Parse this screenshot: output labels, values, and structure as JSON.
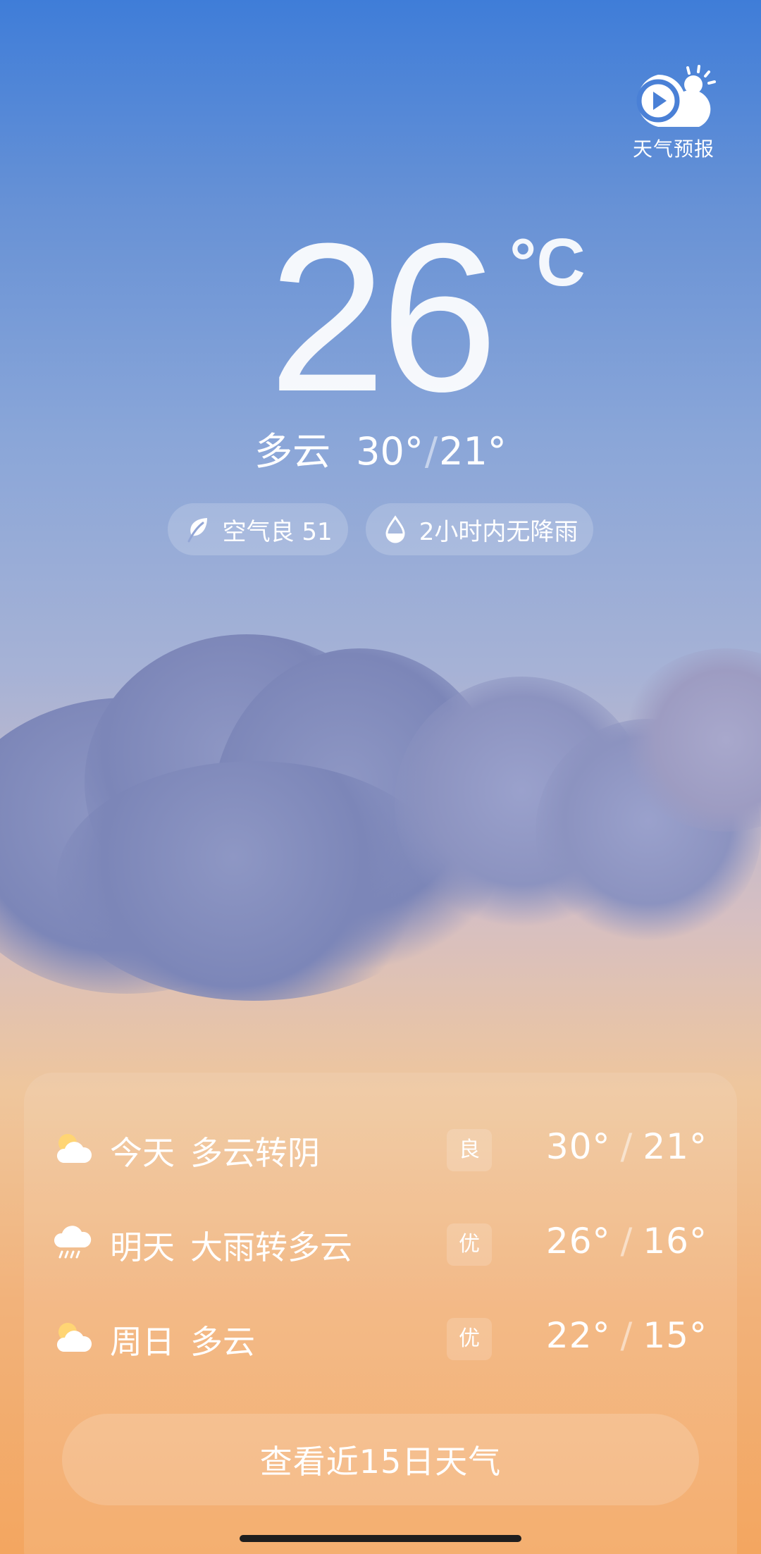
{
  "logo": {
    "label": "天气预报",
    "icon": "weather-forecast-video-icon"
  },
  "current": {
    "temperature": "26",
    "unit": "°C",
    "condition": "多云",
    "high": "30°",
    "separator": "/",
    "low": "21°"
  },
  "chips": {
    "air": {
      "icon": "leaf-icon",
      "label": "空气良 51"
    },
    "rain": {
      "icon": "water-drop-icon",
      "label": "2小时内无降雨"
    }
  },
  "forecast": [
    {
      "day": "今天",
      "condition": "多云转阴",
      "aqi": "良",
      "high": "30°",
      "separator": "/",
      "low": "21°",
      "icon": "partly-cloudy-icon"
    },
    {
      "day": "明天",
      "condition": "大雨转多云",
      "aqi": "优",
      "high": "26°",
      "separator": "/",
      "low": "16°",
      "icon": "heavy-rain-icon"
    },
    {
      "day": "周日",
      "condition": "多云",
      "aqi": "优",
      "high": "22°",
      "separator": "/",
      "low": "15°",
      "icon": "partly-cloudy-icon"
    }
  ],
  "button": {
    "label": "查看近15日天气"
  },
  "colors": {
    "sky_top": "#3f7dd8",
    "sky_bottom": "#f3a660"
  }
}
